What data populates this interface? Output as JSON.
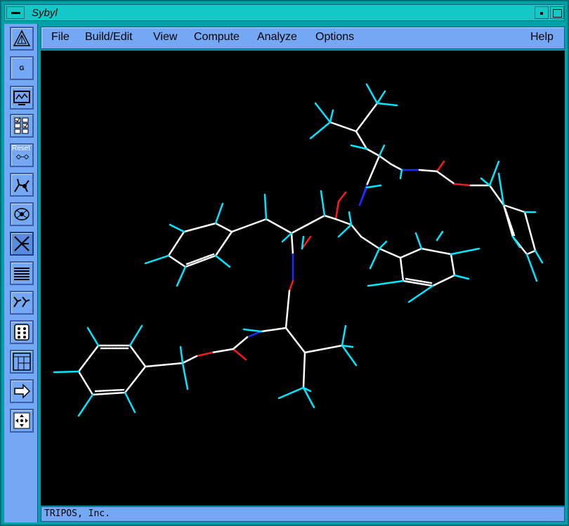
{
  "window": {
    "title": "Sybyl"
  },
  "toolbar": {
    "tools": [
      {
        "name": "tripos-logo-icon"
      },
      {
        "name": "g-icon",
        "label": "G"
      },
      {
        "name": "monitor-icon"
      },
      {
        "name": "checklist-icon"
      },
      {
        "name": "reset-view-icon",
        "label": "Reset"
      },
      {
        "name": "molecule-rotate-icon"
      },
      {
        "name": "atom-label-icon"
      },
      {
        "name": "bond-select-icon"
      },
      {
        "name": "layers-icon"
      },
      {
        "name": "compare-molecules-icon"
      },
      {
        "name": "grid-dots-icon"
      },
      {
        "name": "spreadsheet-icon"
      },
      {
        "name": "export-arrow-icon"
      },
      {
        "name": "move-arrows-icon"
      }
    ]
  },
  "menubar": {
    "items": [
      "File",
      "Build/Edit",
      "View",
      "Compute",
      "Analyze",
      "Options"
    ],
    "help": "Help"
  },
  "colors": {
    "carbon": "#ffffff",
    "hydrogen": "#00e8ff",
    "oxygen": "#ff1a1a",
    "nitrogen": "#1c2cff",
    "background": "#000000",
    "panel": "#74a8f4",
    "frame": "#00a0a8"
  },
  "status": {
    "text": "TRIPOS, Inc."
  }
}
